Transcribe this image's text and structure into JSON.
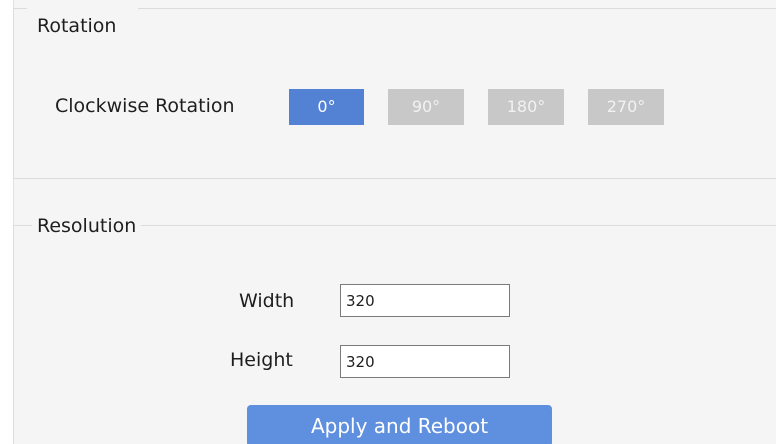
{
  "rotation": {
    "title": "Rotation",
    "label": "Clockwise Rotation",
    "selected": "0°",
    "options": [
      "0°",
      "90°",
      "180°",
      "270°"
    ]
  },
  "resolution": {
    "title": "Resolution",
    "width_label": "Width",
    "width_value": "320",
    "height_label": "Height",
    "height_value": "320"
  },
  "actions": {
    "apply_label": "Apply and Reboot"
  },
  "colors": {
    "accent": "#5381d3",
    "disabled": "#c8c8c8",
    "panel": "#f5f5f5"
  }
}
